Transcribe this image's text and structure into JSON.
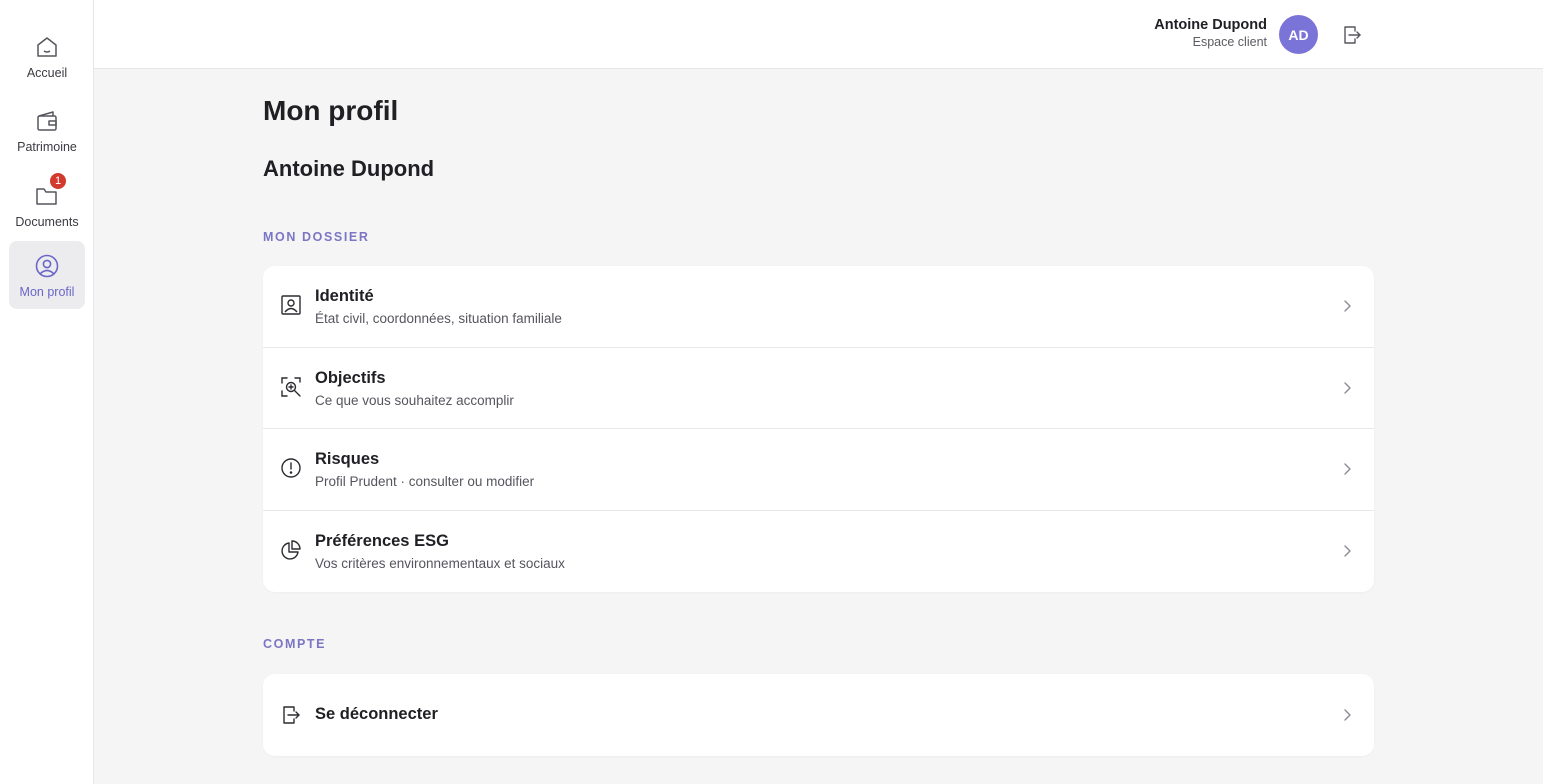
{
  "sidebar": {
    "items": [
      {
        "label": "Accueil",
        "icon": "home-icon"
      },
      {
        "label": "Patrimoine",
        "icon": "wallet-icon"
      },
      {
        "label": "Documents",
        "icon": "folder-icon",
        "badge": "1"
      },
      {
        "label": "Mon profil",
        "icon": "user-circle-icon",
        "active": true
      }
    ]
  },
  "header": {
    "user_name": "Antoine Dupond",
    "user_subtitle": "Espace client",
    "avatar_initials": "AD",
    "logout_icon": "logout-icon"
  },
  "main": {
    "page_title": "Mon profil",
    "user_heading": "Antoine Dupond",
    "dossier_section": {
      "label": "MON DOSSIER",
      "rows": [
        {
          "title": "Identité",
          "subtitle": "État civil, coordonnées, situation familiale",
          "icon": "id-card-icon"
        },
        {
          "title": "Objectifs",
          "subtitle": "Ce que vous souhaitez accomplir",
          "icon": "target-search-icon"
        },
        {
          "title": "Risques",
          "subtitle": "Profil Prudent · consulter ou modifier",
          "icon": "alert-circle-icon"
        },
        {
          "title": "Préférences ESG",
          "subtitle": "Vos critères environnementaux et sociaux",
          "icon": "pie-chart-icon"
        }
      ]
    },
    "account_section": {
      "label": "COMPTE",
      "rows": [
        {
          "title": "Se déconnecter",
          "icon": "logout-icon"
        }
      ]
    }
  },
  "colors": {
    "accent": "#7a74d8",
    "section_label": "#7a76c4",
    "badge": "#d23a2f",
    "background": "#f5f5f6"
  }
}
